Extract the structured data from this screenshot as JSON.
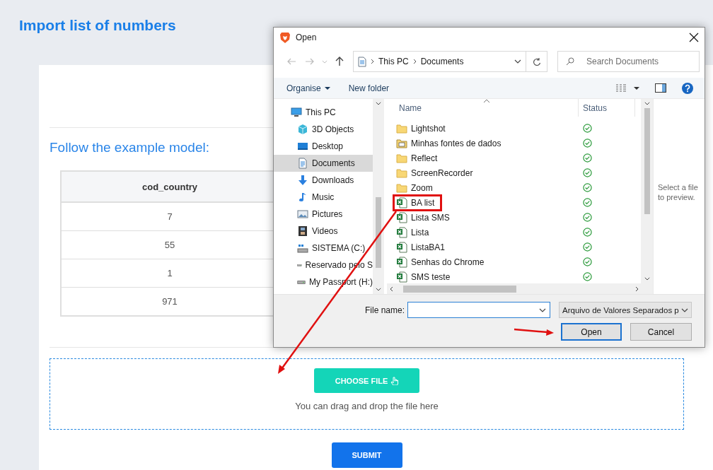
{
  "page": {
    "title": "Import list of numbers",
    "example_heading": "Follow the example model:",
    "table": {
      "columns": [
        "cod_country"
      ],
      "rows": [
        [
          "7"
        ],
        [
          "55"
        ],
        [
          "1"
        ],
        [
          "971"
        ]
      ]
    },
    "choose_file": "CHOOSE FILE",
    "drop_hint": "You can drag and drop the file here",
    "submit": "SUBMIT"
  },
  "dialog": {
    "title": "Open",
    "breadcrumb": [
      "This PC",
      "Documents"
    ],
    "search": {
      "placeholder": "Search Documents"
    },
    "toolbar": {
      "organise": "Organise",
      "new_folder": "New folder"
    },
    "nav": [
      {
        "label": "This PC",
        "kind": "pc",
        "selected": false,
        "children": [
          {
            "label": "3D Objects",
            "kind": "cube",
            "selected": false
          },
          {
            "label": "Desktop",
            "kind": "desktop",
            "selected": false
          },
          {
            "label": "Documents",
            "kind": "documents",
            "selected": true
          },
          {
            "label": "Downloads",
            "kind": "downloads",
            "selected": false
          },
          {
            "label": "Music",
            "kind": "music",
            "selected": false
          },
          {
            "label": "Pictures",
            "kind": "pictures",
            "selected": false
          },
          {
            "label": "Videos",
            "kind": "videos",
            "selected": false
          },
          {
            "label": "SISTEMA (C:)",
            "kind": "system-drive",
            "selected": false
          },
          {
            "label": "Reservado pelo S",
            "kind": "drive",
            "selected": false
          },
          {
            "label": "My Passport (H:)",
            "kind": "drive",
            "selected": false
          }
        ]
      }
    ],
    "columns": [
      "Name",
      "Status"
    ],
    "files": [
      {
        "name": "Lightshot",
        "kind": "folder",
        "synced": true,
        "highlighted": false
      },
      {
        "name": "Minhas fontes de dados",
        "kind": "data-folder",
        "synced": true,
        "highlighted": false
      },
      {
        "name": "Reflect",
        "kind": "folder",
        "synced": true,
        "highlighted": false
      },
      {
        "name": "ScreenRecorder",
        "kind": "folder",
        "synced": true,
        "highlighted": false
      },
      {
        "name": "Zoom",
        "kind": "folder",
        "synced": true,
        "highlighted": false
      },
      {
        "name": "BA list",
        "kind": "spreadsheet",
        "synced": true,
        "highlighted": true
      },
      {
        "name": "Lista SMS",
        "kind": "spreadsheet",
        "synced": true,
        "highlighted": false
      },
      {
        "name": "Lista",
        "kind": "spreadsheet",
        "synced": true,
        "highlighted": false
      },
      {
        "name": "ListaBA1",
        "kind": "spreadsheet",
        "synced": true,
        "highlighted": false
      },
      {
        "name": "Senhas do Chrome",
        "kind": "spreadsheet",
        "synced": true,
        "highlighted": false
      },
      {
        "name": "SMS teste",
        "kind": "spreadsheet",
        "synced": true,
        "highlighted": false
      }
    ],
    "preview_hint": "Select a file to preview.",
    "file_name": {
      "label": "File name:"
    },
    "file_type": "Arquivo de Valores Separados p",
    "buttons": [
      {
        "label": "Open",
        "default": true
      },
      {
        "label": "Cancel",
        "default": false
      }
    ]
  }
}
